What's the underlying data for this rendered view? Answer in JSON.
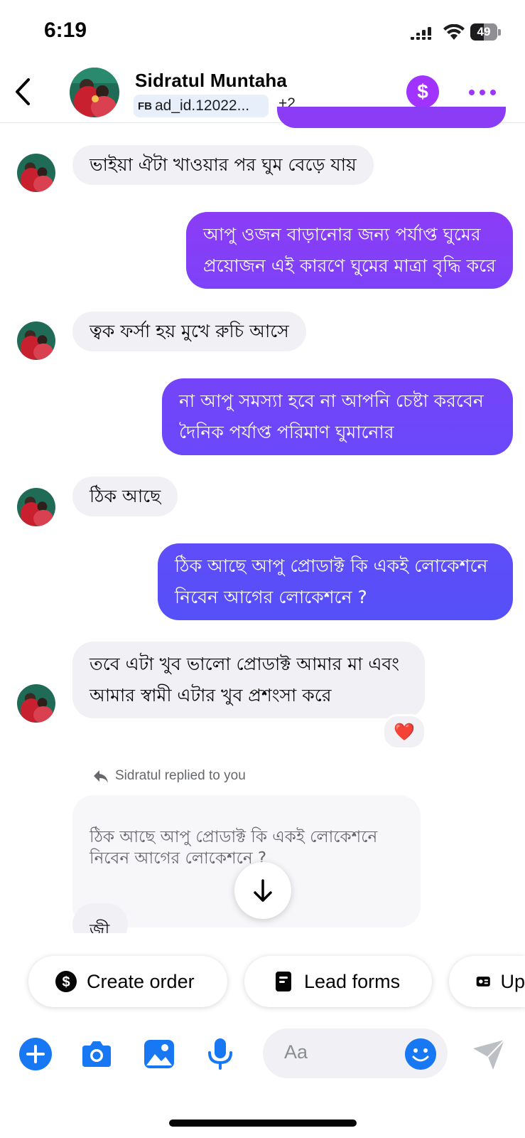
{
  "status_bar": {
    "time": "6:19",
    "battery": "49",
    "battery_level": 0.49
  },
  "header": {
    "contact_name": "Sidratul Muntaha",
    "ad_prefix": "FB",
    "ad_id": "ad_id.12022...",
    "more_tags": "+2"
  },
  "messages": [
    {
      "direction": "in",
      "text": "ভাইয়া ঐটা খাওয়ার পর ঘুম বেড়ে যায়"
    },
    {
      "direction": "out",
      "text_lines": [
        "আপু ওজন বাড়ানোর জন্য পর্যাপ্ত ঘুমের",
        "প্রয়োজন এই কারণে ঘুমের মাত্রা বৃদ্ধি করে"
      ]
    },
    {
      "direction": "in",
      "text": "ত্বক ফর্সা হয় মুখে রুচি আসে"
    },
    {
      "direction": "out",
      "text_lines": [
        "না আপু সমস্যা হবে না আপনি চেষ্টা করবেন",
        "দৈনিক পর্যাপ্ত পরিমাণ ঘুমানোর"
      ]
    },
    {
      "direction": "in",
      "text": "ঠিক আছে"
    },
    {
      "direction": "out",
      "text_lines": [
        "ঠিক আছে আপু প্রোডাক্ট কি একই লোকেশনে",
        "নিবেন আগের লোকেশনে ?"
      ]
    },
    {
      "direction": "in",
      "text_lines": [
        "তবে এটা খুব ভালো প্রোডাক্ট আমার মা এবং",
        "আমার স্বামী এটার খুব প্রশংসা করে"
      ],
      "reaction": "❤️"
    }
  ],
  "reply": {
    "label": "Sidratul replied to you",
    "quoted_lines": [
      "ঠিক আছে আপু প্রোডাক্ট কি একই লোকেশনে",
      "নিবেন আগের লোকেশনে ?"
    ],
    "text": "জী"
  },
  "chips": [
    {
      "label": "Create order",
      "icon": "dollar-circle-icon"
    },
    {
      "label": "Lead forms",
      "icon": "form-icon"
    },
    {
      "label": "Up",
      "icon": "id-card-icon"
    }
  ],
  "composer": {
    "placeholder": "Aa"
  },
  "colors": {
    "accent": "#a033ff",
    "blue": "#1877f2",
    "incoming_bubble": "#f0f0f5"
  }
}
